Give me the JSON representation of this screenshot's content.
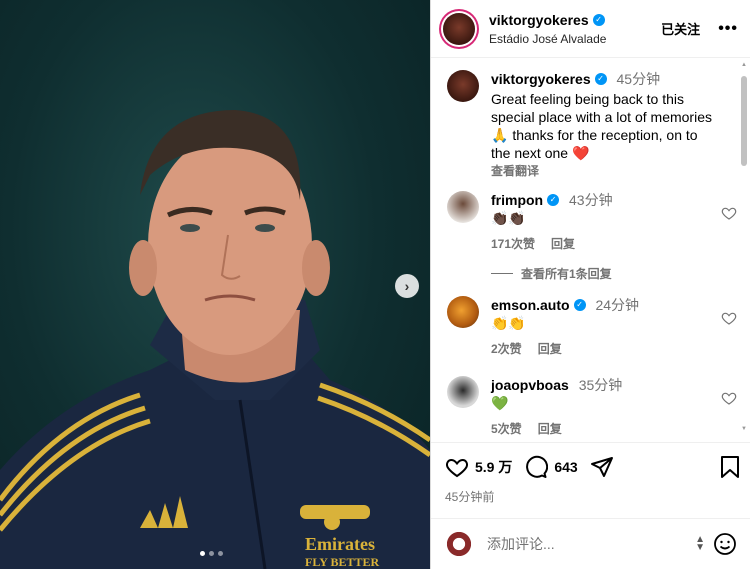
{
  "post": {
    "username": "viktorgyokeres",
    "location": "Estádio José Alvalade",
    "follow_status": "已关注",
    "more_label": "•••"
  },
  "caption": {
    "username": "viktorgyokeres",
    "time": "45分钟",
    "line1": "Great feeling being back to this",
    "line2": "special place with a lot of memories",
    "line3": "🙏 thanks for the reception, on to",
    "line4": "the next one ❤️",
    "translate": "查看翻译"
  },
  "comments": [
    {
      "username": "frimpon",
      "time": "43分钟",
      "text": "👏🏿👏🏿",
      "likes": "171次赞",
      "reply": "回复"
    },
    {
      "username": "emson.auto",
      "time": "24分钟",
      "text": "👏👏",
      "likes": "2次赞",
      "reply": "回复"
    },
    {
      "username": "joaopvboas",
      "time": "35分钟",
      "text": "💚",
      "likes": "5次赞",
      "reply": "回复"
    }
  ],
  "view_replies": "查看所有1条回复",
  "actions": {
    "likes": "5.9 万",
    "comments": "643"
  },
  "posted_time": "45分钟前",
  "comment_box": {
    "placeholder": "添加评论..."
  },
  "media": {
    "slide_index": 1,
    "slide_count": 3,
    "kit_text_1": "Emirates",
    "kit_text_2": "FLY BETTER"
  },
  "icons": {
    "next": "chevron-right-icon",
    "heart": "heart-icon",
    "comment": "comment-icon",
    "share": "share-icon",
    "bookmark": "bookmark-icon",
    "emoji": "emoji-icon"
  }
}
